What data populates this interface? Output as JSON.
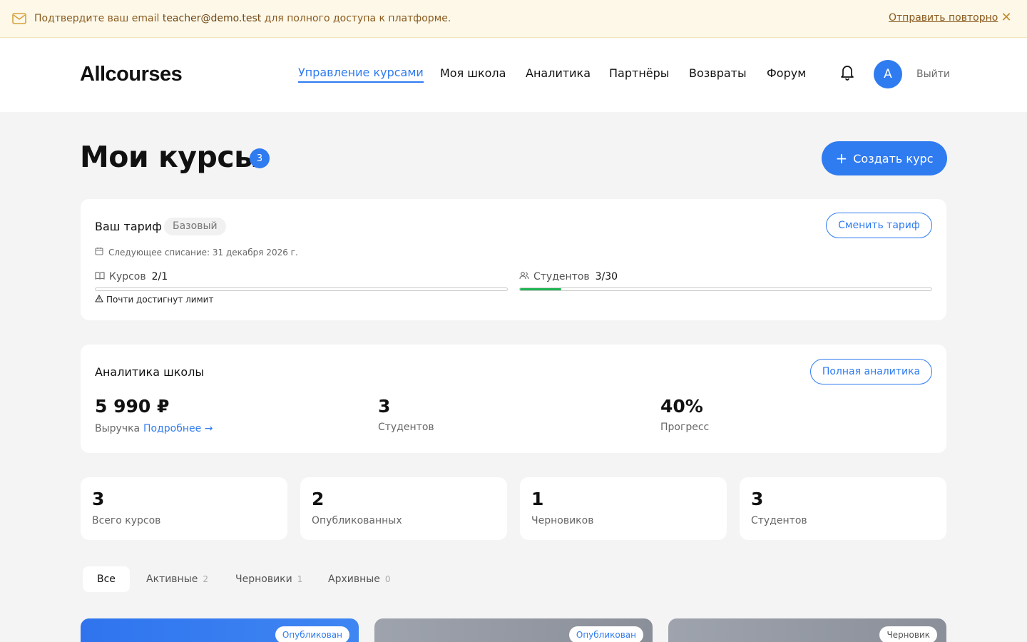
{
  "banner": {
    "message_prefix": "Подтвердите ваш email ",
    "email": "teacher@demo.test",
    "message_suffix": " для полного доступа к платформе.",
    "resend_label": "Отправить повторно",
    "close_icon": "close-icon"
  },
  "header": {
    "logo": "Allcourses",
    "nav": [
      {
        "label": "Управление курсами",
        "active": true
      },
      {
        "label": "Моя школа"
      },
      {
        "label": "Аналитика"
      },
      {
        "label": "Партнёры"
      },
      {
        "label": "Возвраты"
      },
      {
        "label": "Форум"
      }
    ],
    "avatar_letter": "A",
    "logout_label": "Выйти"
  },
  "page": {
    "title": "Мои курсы",
    "count_badge": "3",
    "create_button": "Создать курс"
  },
  "tariff": {
    "label": "Ваш тариф",
    "plan": "Базовый",
    "change_button": "Сменить тариф",
    "next_charge": "Следующее списание: 31 декабря 2026 г.",
    "courses_label": "Курсов",
    "courses_value": "2/1",
    "courses_fill": 0,
    "students_label": "Студентов",
    "students_value": "3/30",
    "students_fill": 0.1,
    "warning": "Почти достигнут лимит"
  },
  "analytics": {
    "title": "Аналитика школы",
    "full_button": "Полная аналитика",
    "revenue_value": "5 990 ₽",
    "revenue_label": "Выручка",
    "revenue_link": "Подробнее →",
    "students_value": "3",
    "students_label": "Студентов",
    "progress_value": "40%",
    "progress_label": "Прогресс"
  },
  "stats": [
    {
      "value": "3",
      "label": "Всего курсов"
    },
    {
      "value": "2",
      "label": "Опубликованных"
    },
    {
      "value": "1",
      "label": "Черновиков"
    },
    {
      "value": "3",
      "label": "Студентов"
    }
  ],
  "tabs": [
    {
      "label": "Все",
      "count": "",
      "active": true
    },
    {
      "label": "Активные",
      "count": "2"
    },
    {
      "label": "Черновики",
      "count": "1"
    },
    {
      "label": "Архивные",
      "count": "0"
    }
  ],
  "courses": [
    {
      "status": "Опубликован",
      "color": "#2f74ee"
    },
    {
      "status": "Опубликован",
      "color": "#9ea3ad"
    },
    {
      "status": "Черновик",
      "color": "#9ea3ad"
    }
  ]
}
